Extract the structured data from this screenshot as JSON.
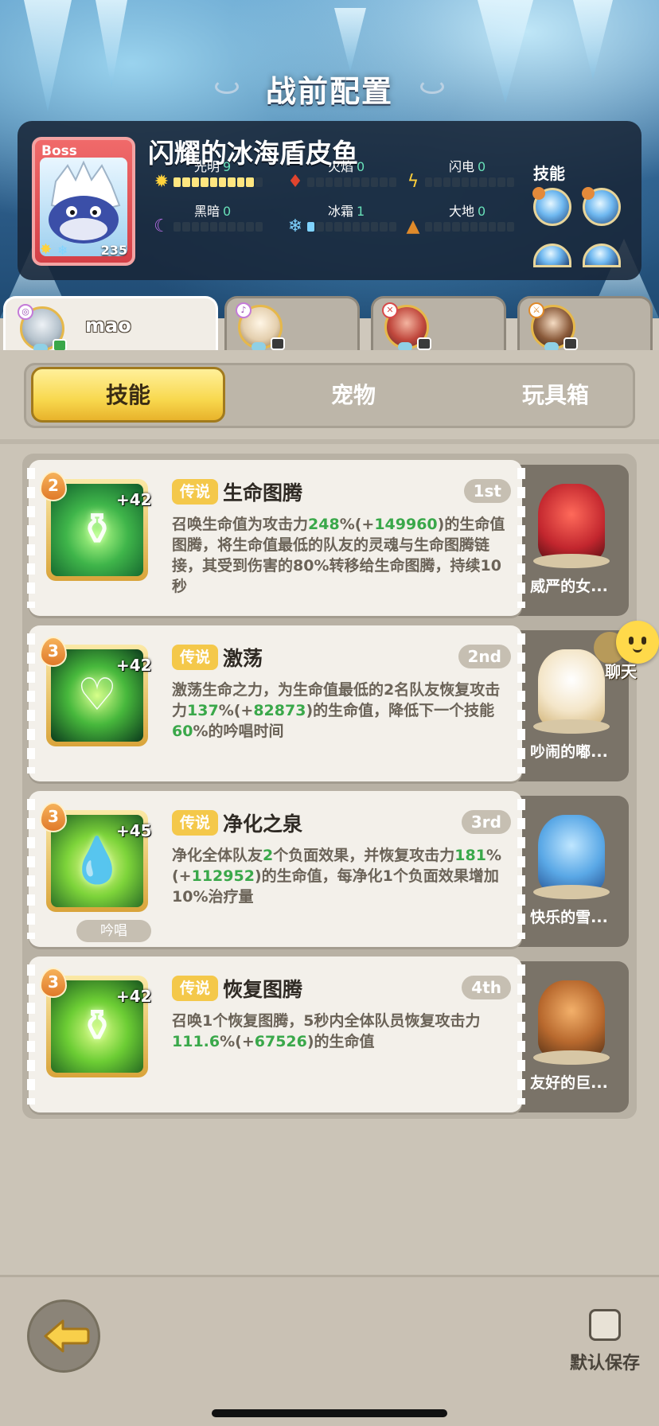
{
  "page_title": "战前配置",
  "boss": {
    "tag": "Boss",
    "name": "闪耀的冰海盾皮鱼",
    "level": "235",
    "skills_label": "技能",
    "elements": [
      {
        "name": "光明",
        "value": "9",
        "icon": "sun-icon",
        "filled": 9
      },
      {
        "name": "火焰",
        "value": "0",
        "icon": "fire-icon",
        "filled": 0
      },
      {
        "name": "闪电",
        "value": "0",
        "icon": "lightning-icon",
        "filled": 0
      },
      {
        "name": "黑暗",
        "value": "0",
        "icon": "moon-icon",
        "filled": 0
      },
      {
        "name": "冰霜",
        "value": "1",
        "icon": "snowflake-icon",
        "filled": 1
      },
      {
        "name": "大地",
        "value": "0",
        "icon": "earth-icon",
        "filled": 0
      }
    ]
  },
  "players": [
    {
      "name": "mao",
      "active": true
    },
    {
      "name": "",
      "active": false
    },
    {
      "name": "",
      "active": false
    },
    {
      "name": "",
      "active": false
    }
  ],
  "tabs": [
    {
      "label": "技能",
      "active": true
    },
    {
      "label": "宠物",
      "active": false
    },
    {
      "label": "玩具箱",
      "active": false
    }
  ],
  "skills": [
    {
      "level": "2",
      "plus": "+42",
      "tag": "传说",
      "name": "生命图腾",
      "rank": "1st",
      "desc_parts": [
        "召唤生命值为攻击力",
        "248",
        "%(+",
        "149960",
        ")的生命值图腾，将生命值最低的队友的灵魂与生命图腾链接，其受到伤害的80%转移给生命图腾，持续10秒"
      ],
      "pet_name": "威严的女...",
      "icon": "totem-icon",
      "chant": ""
    },
    {
      "level": "3",
      "plus": "+42",
      "tag": "传说",
      "name": "激荡",
      "rank": "2nd",
      "desc_parts": [
        "激荡生命之力，为生命值最低的2名队友恢复攻击力",
        "137",
        "%(+",
        "82873",
        ")的生命值，降低下一个技能",
        "60",
        "%的吟唱时间"
      ],
      "pet_name": "吵闹的嘟...",
      "icon": "heart-cross-icon",
      "chant": ""
    },
    {
      "level": "3",
      "plus": "+45",
      "tag": "传说",
      "name": "净化之泉",
      "rank": "3rd",
      "desc_parts": [
        "净化全体队友",
        "2",
        "个负面效果，并恢复攻击力",
        "181",
        "%(+",
        "112952",
        ")的生命值，每净化1个负面效果增加10%治疗量"
      ],
      "pet_name": "快乐的雪...",
      "icon": "water-drop-icon",
      "chant": "吟唱"
    },
    {
      "level": "3",
      "plus": "+42",
      "tag": "传说",
      "name": "恢复图腾",
      "rank": "4th",
      "desc_parts": [
        "召唤1个恢复图腾，5秒内全体队员恢复攻击力",
        "111.6",
        "%(+",
        "67526",
        ")的生命值"
      ],
      "pet_name": "友好的巨...",
      "icon": "totem-icon",
      "chant": ""
    }
  ],
  "chat_label": "聊天",
  "save_label": "默认保存",
  "colors": {
    "accent_gold": "#f8d84e",
    "highlight_green": "#3aa84a",
    "element_value": "#68e0b8"
  }
}
